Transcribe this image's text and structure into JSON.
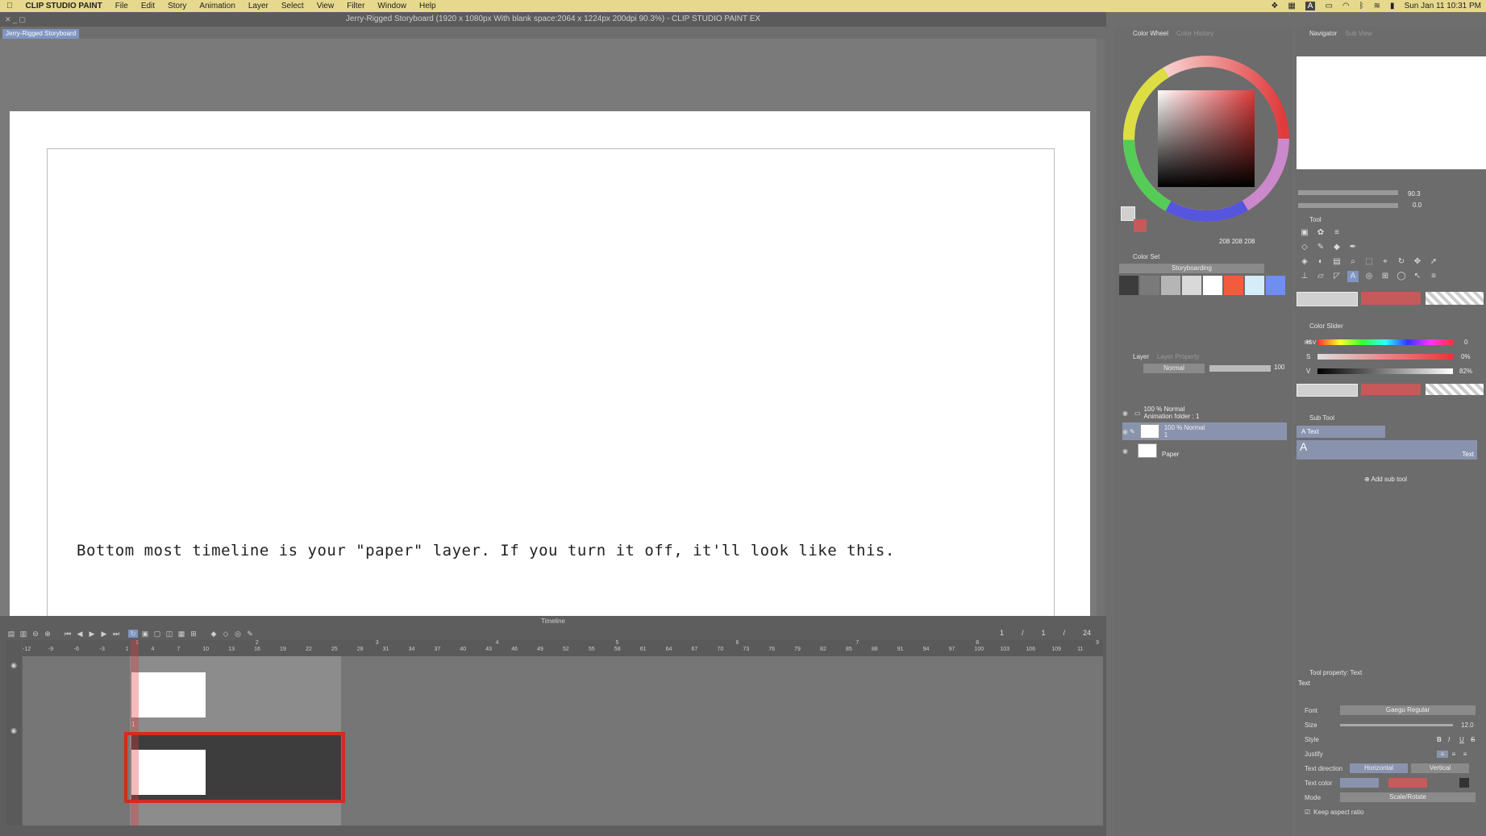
{
  "menubar": {
    "apple": "",
    "app_name": "CLIP STUDIO PAINT",
    "items": [
      "File",
      "Edit",
      "Story",
      "Animation",
      "Layer",
      "Select",
      "View",
      "Filter",
      "Window",
      "Help"
    ],
    "clock": "Sun Jan 11  10:31 PM",
    "input_badge": "A"
  },
  "window": {
    "title": "Jerry-Rigged Storyboard (1920 x 1080px With blank space:2064 x 1224px 200dpi 90.3%)  - CLIP STUDIO PAINT EX",
    "doc_tab": "Jerry-Rigged Storyboard"
  },
  "canvas": {
    "caption": "Bottom most timeline is your \"paper\" layer. If you turn it off, it'll look like this."
  },
  "timeline": {
    "title": "Timeline",
    "frame_current": "1",
    "frame_sep": "/",
    "frame_start": "1",
    "frame_end": "24",
    "ruler_ticks": [
      "-12",
      "-9",
      "-6",
      "-3",
      "1",
      "4",
      "7",
      "10",
      "13",
      "16",
      "19",
      "22",
      "25",
      "28",
      "31",
      "34",
      "37",
      "40",
      "43",
      "46",
      "49",
      "52",
      "55",
      "58",
      "61",
      "64",
      "67",
      "70",
      "73",
      "76",
      "79",
      "82",
      "85",
      "88",
      "91",
      "94",
      "97",
      "100",
      "103",
      "106",
      "109",
      "11"
    ],
    "second_markers": [
      "1",
      "2",
      "3",
      "4",
      "5",
      "6",
      "7",
      "8",
      "9"
    ],
    "cell_label": "1"
  },
  "color_wheel": {
    "tab_active": "Color Wheel",
    "tab_inactive": "Color History",
    "rgb": "208  208  208",
    "main_color": "#d0d0d0",
    "sub_color": "#c65a5a"
  },
  "color_set": {
    "title": "Color Set",
    "set_name": "Storyboarding",
    "swatches": [
      "#3c3c3c",
      "#7a7a7a",
      "#b5b5b5",
      "#d9d9d9",
      "#ffffff",
      "#f25c3c",
      "#d6ecf8",
      "#6f8ff0"
    ]
  },
  "layer": {
    "tab_active": "Layer",
    "tab_inactive": "Layer Property",
    "blend_mode": "Normal",
    "opacity": "100",
    "rows": [
      {
        "line1": "100 % Normal",
        "line2": "Animation folder : 1"
      },
      {
        "line1": "100 % Normal",
        "line2": "1"
      },
      {
        "line1": "Paper",
        "line2": ""
      }
    ]
  },
  "navigator": {
    "tab_active": "Navigator",
    "tab_inactive": "Sub View",
    "zoom": "90.3",
    "rotation": "0.0"
  },
  "tool": {
    "title": "Tool"
  },
  "color_slider": {
    "title": "Color Slider",
    "mode": "HSV",
    "h_label": "H",
    "h_value": "0",
    "s_label": "S",
    "s_value": "0%",
    "v_label": "V",
    "v_value": "82%"
  },
  "sub_tool": {
    "title": "Sub Tool",
    "item_label": "Text",
    "preview_label": "Text",
    "add_label": "Add sub tool"
  },
  "tool_property": {
    "title": "Tool property: Text",
    "subtitle": "Text",
    "font_label": "Font",
    "font_value": "Gaegu Regular",
    "size_label": "Size",
    "size_value": "12.0",
    "style_label": "Style",
    "style_buttons": [
      "B",
      "I",
      "U",
      "S"
    ],
    "justify_label": "Justify",
    "direction_label": "Text direction",
    "direction_horizontal": "Horizontal",
    "direction_vertical": "Vertical",
    "color_label": "Text color",
    "mode_label": "Mode",
    "mode_value": "Scale/Rotate",
    "aspect_label": "Keep aspect ratio"
  }
}
